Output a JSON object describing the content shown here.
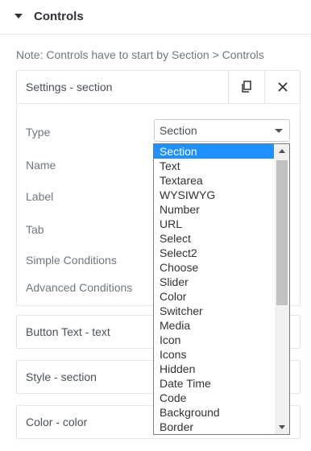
{
  "panel": {
    "title": "Controls"
  },
  "note": "Note: Controls have to start by Section > Controls",
  "settings_section": {
    "title": "Settings - section",
    "fields": {
      "type_label": "Type",
      "name_label": "Name",
      "label_label": "Label",
      "tab_label": "Tab",
      "simple_conditions_label": "Simple Conditions",
      "advanced_conditions_label": "Advanced Conditions"
    },
    "type_select": {
      "value": "Section",
      "options": [
        "Section",
        "Text",
        "Textarea",
        "WYSIWYG",
        "Number",
        "URL",
        "Select",
        "Select2",
        "Choose",
        "Slider",
        "Color",
        "Switcher",
        "Media",
        "Icon",
        "Icons",
        "Hidden",
        "Date Time",
        "Code",
        "Background",
        "Border"
      ]
    }
  },
  "other_sections": [
    {
      "title": "Button Text - text"
    },
    {
      "title": "Style - section"
    },
    {
      "title": "Color - color"
    }
  ],
  "icons": [
    "caret-down-icon",
    "copy-icon",
    "close-icon",
    "chevron-down-icon",
    "scroll-up-icon",
    "scroll-down-icon"
  ],
  "colors": {
    "selected_option_bg": "#1e90ff",
    "text": "#495157",
    "border": "#e6e9ec"
  }
}
